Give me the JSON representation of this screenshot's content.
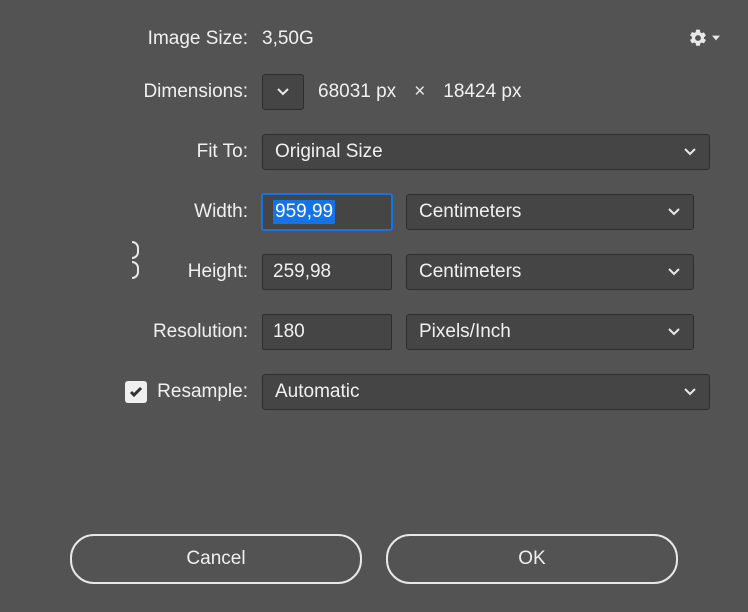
{
  "labels": {
    "image_size": "Image Size:",
    "dimensions": "Dimensions:",
    "fit_to": "Fit To:",
    "width": "Width:",
    "height": "Height:",
    "resolution": "Resolution:",
    "resample": "Resample:"
  },
  "image_size_value": "3,50G",
  "dimensions": {
    "width_px": "68031 px",
    "height_px": "18424 px"
  },
  "fit_to": {
    "selected": "Original Size"
  },
  "width": {
    "value": "959,99",
    "unit": "Centimeters"
  },
  "height": {
    "value": "259,98",
    "unit": "Centimeters"
  },
  "resolution": {
    "value": "180",
    "unit": "Pixels/Inch"
  },
  "resample": {
    "checked": true,
    "mode": "Automatic"
  },
  "buttons": {
    "cancel": "Cancel",
    "ok": "OK"
  }
}
